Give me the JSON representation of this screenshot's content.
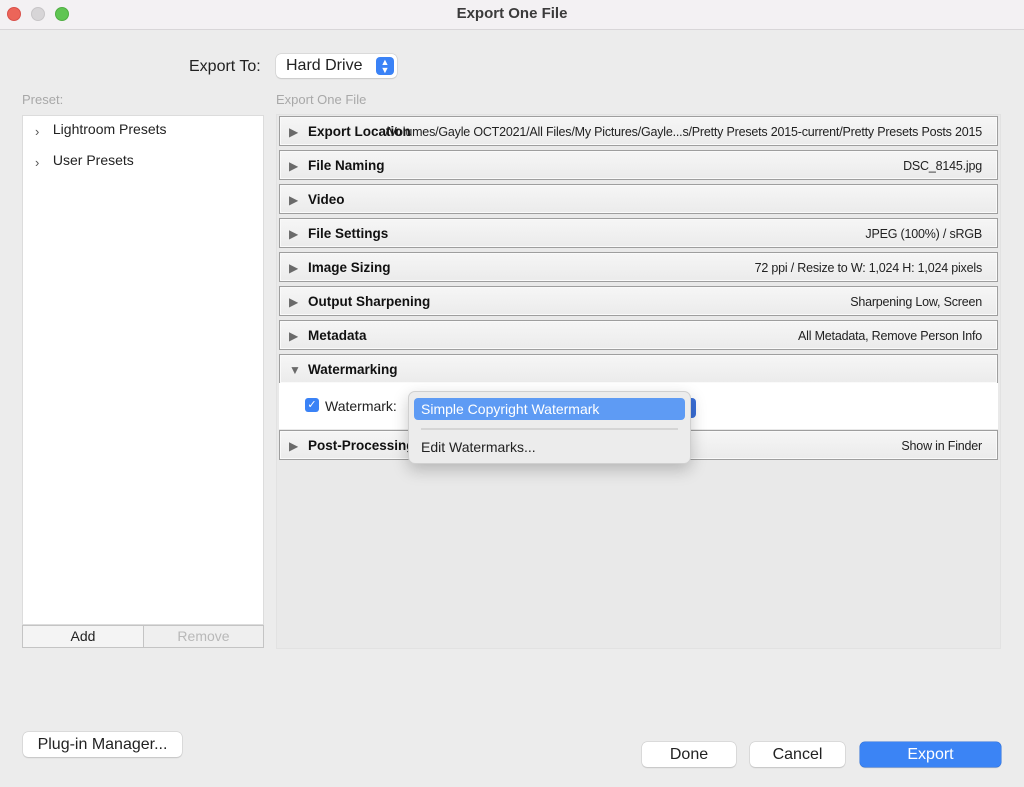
{
  "window": {
    "title": "Export One File"
  },
  "export_to": {
    "label": "Export To:",
    "value": "Hard Drive",
    "stepper_icon": "⌃⌄"
  },
  "preset_panel": {
    "label": "Preset:",
    "items": [
      {
        "label": "Lightroom Presets",
        "icon": "›"
      },
      {
        "label": "User Presets",
        "icon": "›"
      }
    ],
    "add_label": "Add",
    "remove_label": "Remove"
  },
  "main": {
    "section_label": "Export One File",
    "sections": [
      {
        "name": "Export Location",
        "summary": "/Volumes/Gayle OCT2021/All Files/My Pictures/Gayle...s/Pretty Presets 2015-current/Pretty Presets Posts 2015",
        "expanded": false
      },
      {
        "name": "File Naming",
        "summary": "DSC_8145.jpg",
        "expanded": false
      },
      {
        "name": "Video",
        "summary": "",
        "expanded": false
      },
      {
        "name": "File Settings",
        "summary": "JPEG (100%) / sRGB",
        "expanded": false
      },
      {
        "name": "Image Sizing",
        "summary": "72 ppi / Resize to W: 1,024 H: 1,024 pixels",
        "expanded": false
      },
      {
        "name": "Output Sharpening",
        "summary": "Sharpening Low, Screen",
        "expanded": false
      },
      {
        "name": "Metadata",
        "summary": "All Metadata, Remove Person Info",
        "expanded": false
      },
      {
        "name": "Watermarking",
        "summary": "",
        "expanded": true
      },
      {
        "name": "Post-Processing",
        "summary": "Show in Finder",
        "expanded": false
      }
    ],
    "collapsed_icon": "▶",
    "expanded_icon": "▼",
    "watermark": {
      "checked": true,
      "check_icon": "✓",
      "label": "Watermark:",
      "selected": "Simple Copyright Watermark"
    }
  },
  "watermark_menu": {
    "items": [
      "Simple Copyright Watermark",
      "Edit Watermarks..."
    ],
    "highlighted": "Simple Copyright Watermark"
  },
  "footer": {
    "plugin_manager_label": "Plug-in Manager...",
    "done_label": "Done",
    "cancel_label": "Cancel",
    "export_label": "Export"
  },
  "colors": {
    "accent": "#3b84f5",
    "menu_highlight": "#5e9bf4",
    "close": "#ec6559",
    "maximize": "#5fc552"
  }
}
